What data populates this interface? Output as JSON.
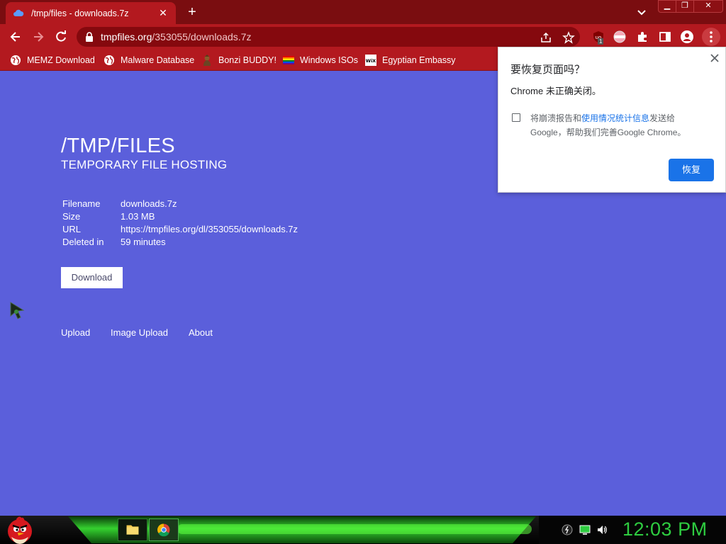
{
  "browser": {
    "tab": {
      "title": "/tmp/files - downloads.7z"
    },
    "address": {
      "host": "tmpfiles.org",
      "path": "/353055/downloads.7z"
    },
    "extension_badge": "1",
    "bookmarks": [
      {
        "label": "MEMZ Download",
        "icon": "globe-icon"
      },
      {
        "label": "Malware Database",
        "icon": "globe-icon"
      },
      {
        "label": "Bonzi BUDDY!",
        "icon": "bonzi-icon"
      },
      {
        "label": "Windows ISOs",
        "icon": "rainbow-flag-icon"
      },
      {
        "label": "Egyptian Embassy",
        "icon": "wix-icon"
      }
    ],
    "theme_color": "#b3191f"
  },
  "page": {
    "title": "/TMP/FILES",
    "subtitle": "TEMPORARY FILE HOSTING",
    "info": [
      {
        "key": "Filename",
        "value": "downloads.7z"
      },
      {
        "key": "Size",
        "value": "1.03 MB"
      },
      {
        "key": "URL",
        "value": "https://tmpfiles.org/dl/353055/downloads.7z"
      },
      {
        "key": "Deleted in",
        "value": "59 minutes"
      }
    ],
    "download_label": "Download",
    "footer_links": [
      "Upload",
      "Image Upload",
      "About"
    ],
    "background": "#5b5fdb"
  },
  "dialog": {
    "title": "要恢复页面吗？",
    "message": "Chrome 未正确关闭。",
    "report_prefix": "将崩溃报告和",
    "report_link": "使用情况统计信息",
    "report_suffix": "发送给",
    "report_line2": "Google，帮助我们完善Google Chrome。",
    "report_checked": false,
    "restore_label": "恢复"
  },
  "taskbar": {
    "clock": "12:03 PM",
    "accent": "#2ecc40"
  }
}
